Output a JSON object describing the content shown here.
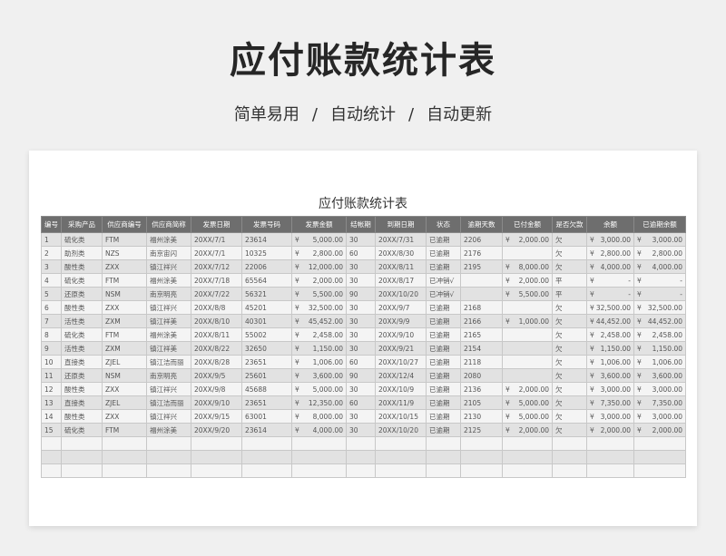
{
  "hero": {
    "title": "应付账款统计表",
    "sub": [
      "简单易用",
      "自动统计",
      "自动更新"
    ],
    "separator": "/"
  },
  "sheet": {
    "title": "应付账款统计表",
    "currency": "¥",
    "headers": [
      "编号",
      "采购产品",
      "供应商编号",
      "供应商简称",
      "发票日期",
      "发票号码",
      "发票金额",
      "结帐期",
      "到期日期",
      "状态",
      "逾期天数",
      "已付金额",
      "是否欠款",
      "余额",
      "已逾期余额"
    ],
    "rows": [
      [
        "1",
        "硫化类",
        "FTM",
        "福州涂美",
        "20XX/7/1",
        "23614",
        "5,000.00",
        "30",
        "20XX/7/31",
        "已逾期",
        "2206",
        "2,000.00",
        "欠",
        "3,000.00",
        "3,000.00"
      ],
      [
        "2",
        "助剂类",
        "NZS",
        "南京宙闪",
        "20XX/7/1",
        "10325",
        "2,800.00",
        "60",
        "20XX/8/30",
        "已逾期",
        "2176",
        "",
        "欠",
        "2,800.00",
        "2,800.00"
      ],
      [
        "3",
        "酸性类",
        "ZXX",
        "镇江祥兴",
        "20XX/7/12",
        "22006",
        "12,000.00",
        "30",
        "20XX/8/11",
        "已逾期",
        "2195",
        "8,000.00",
        "欠",
        "4,000.00",
        "4,000.00"
      ],
      [
        "4",
        "硫化类",
        "FTM",
        "福州涂美",
        "20XX/7/18",
        "65564",
        "2,000.00",
        "30",
        "20XX/8/17",
        "已冲销√",
        "",
        "2,000.00",
        "平",
        "-",
        "-"
      ],
      [
        "5",
        "还原类",
        "NSM",
        "南京明亮",
        "20XX/7/22",
        "56321",
        "5,500.00",
        "90",
        "20XX/10/20",
        "已冲销√",
        "",
        "5,500.00",
        "平",
        "-",
        "-"
      ],
      [
        "6",
        "酸性类",
        "ZXX",
        "镇江祥兴",
        "20XX/8/8",
        "45201",
        "32,500.00",
        "30",
        "20XX/9/7",
        "已逾期",
        "2168",
        "",
        "欠",
        "32,500.00",
        "32,500.00"
      ],
      [
        "7",
        "活性类",
        "ZXM",
        "镇江祥美",
        "20XX/8/10",
        "40301",
        "45,452.00",
        "30",
        "20XX/9/9",
        "已逾期",
        "2166",
        "1,000.00",
        "欠",
        "44,452.00",
        "44,452.00"
      ],
      [
        "8",
        "硫化类",
        "FTM",
        "福州涂美",
        "20XX/8/11",
        "55002",
        "2,458.00",
        "30",
        "20XX/9/10",
        "已逾期",
        "2165",
        "",
        "欠",
        "2,458.00",
        "2,458.00"
      ],
      [
        "9",
        "活性类",
        "ZXM",
        "镇江祥美",
        "20XX/8/22",
        "32650",
        "1,150.00",
        "30",
        "20XX/9/21",
        "已逾期",
        "2154",
        "",
        "欠",
        "1,150.00",
        "1,150.00"
      ],
      [
        "10",
        "直接类",
        "ZJEL",
        "镇江洁而丽",
        "20XX/8/28",
        "23651",
        "1,006.00",
        "60",
        "20XX/10/27",
        "已逾期",
        "2118",
        "",
        "欠",
        "1,006.00",
        "1,006.00"
      ],
      [
        "11",
        "还原类",
        "NSM",
        "南京明亮",
        "20XX/9/5",
        "25601",
        "3,600.00",
        "90",
        "20XX/12/4",
        "已逾期",
        "2080",
        "",
        "欠",
        "3,600.00",
        "3,600.00"
      ],
      [
        "12",
        "酸性类",
        "ZXX",
        "镇江祥兴",
        "20XX/9/8",
        "45688",
        "5,000.00",
        "30",
        "20XX/10/9",
        "已逾期",
        "2136",
        "2,000.00",
        "欠",
        "3,000.00",
        "3,000.00"
      ],
      [
        "13",
        "直接类",
        "ZJEL",
        "镇江洁而丽",
        "20XX/9/10",
        "23651",
        "12,350.00",
        "60",
        "20XX/11/9",
        "已逾期",
        "2105",
        "5,000.00",
        "欠",
        "7,350.00",
        "7,350.00"
      ],
      [
        "14",
        "酸性类",
        "ZXX",
        "镇江祥兴",
        "20XX/9/15",
        "63001",
        "8,000.00",
        "30",
        "20XX/10/15",
        "已逾期",
        "2130",
        "5,000.00",
        "欠",
        "3,000.00",
        "3,000.00"
      ],
      [
        "15",
        "硫化类",
        "FTM",
        "福州涂美",
        "20XX/9/20",
        "23614",
        "4,000.00",
        "30",
        "20XX/10/20",
        "已逾期",
        "2125",
        "2,000.00",
        "欠",
        "2,000.00",
        "2,000.00"
      ]
    ],
    "empty_rows": 3
  }
}
